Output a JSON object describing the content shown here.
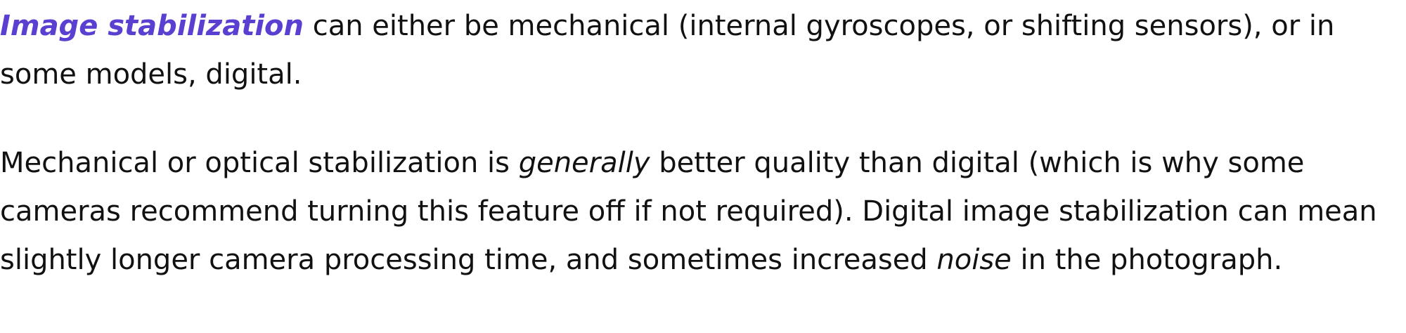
{
  "paragraph_1": {
    "term_link": "Image stabilization",
    "text": " can either be mechanical (internal gyroscopes, or shifting sensors), or in some models, digital."
  },
  "paragraph_2": {
    "text_1": "Mechanical or optical stabilization is ",
    "emphasis_1": "generally",
    "text_2": " better quality than digital (which is why some cameras recommend turning this feature off if not required). Digital image stabilization can mean slightly longer camera processing time, and sometimes increased ",
    "emphasis_2": "noise",
    "text_3": " in the photograph."
  },
  "colors": {
    "link": "#5a3fd0",
    "text": "#111111",
    "background": "#ffffff"
  }
}
